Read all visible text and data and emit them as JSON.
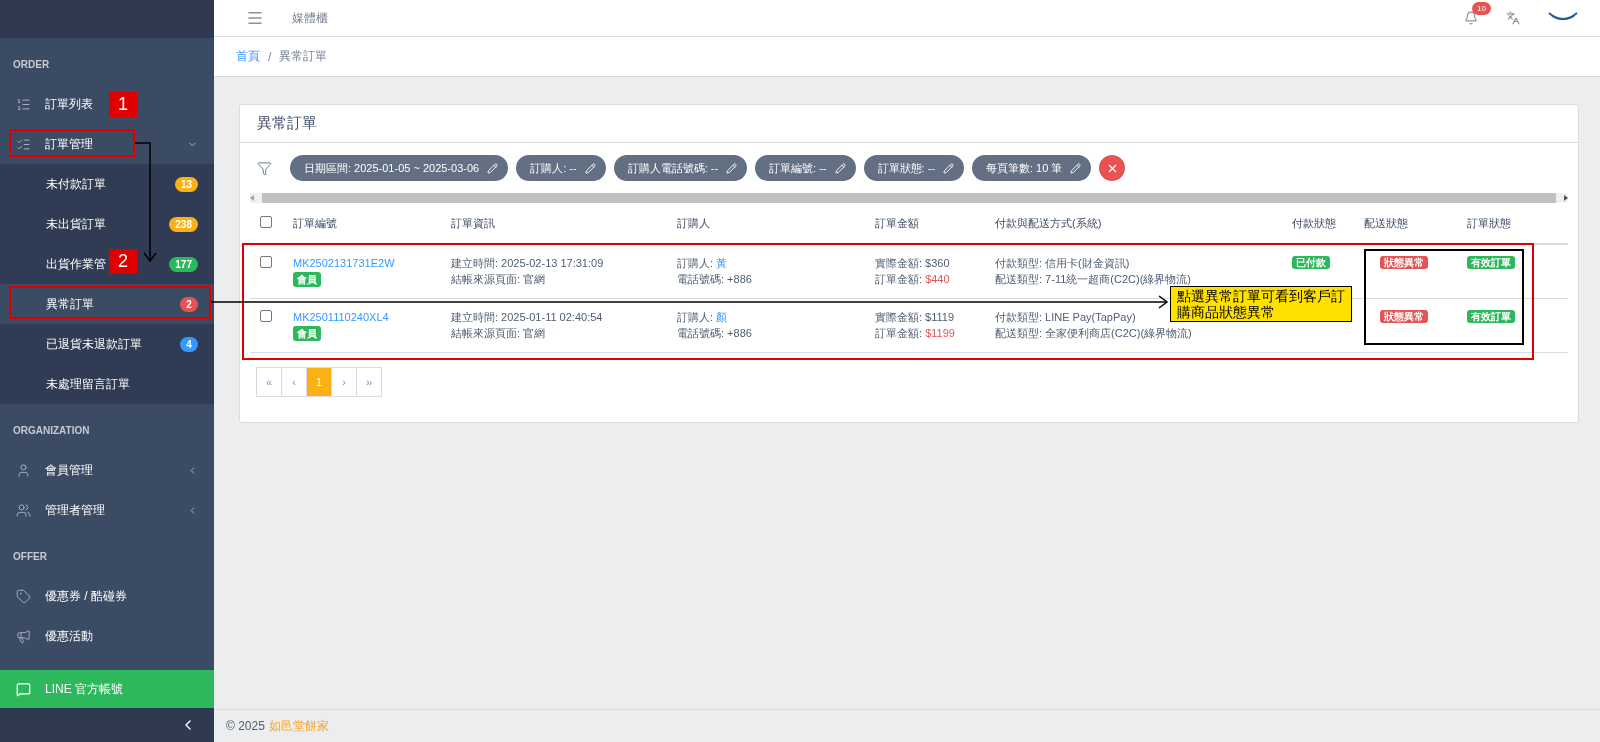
{
  "sidebar": {
    "sections": [
      {
        "heading": "ORDER",
        "items": [
          {
            "label": "訂單列表"
          },
          {
            "label": "訂單管理",
            "expanded": true,
            "children": [
              {
                "label": "未付款訂單",
                "selected": false,
                "badge": {
                  "text": "13",
                  "color": "#f9b115"
                }
              },
              {
                "label": "未出貨訂單",
                "selected": false,
                "badge": {
                  "text": "238",
                  "color": "#f9b115"
                }
              },
              {
                "label": "出貨作業管",
                "selected": false,
                "badge": {
                  "text": "177",
                  "color": "#2eb85c"
                }
              },
              {
                "label": "異常訂單",
                "selected": true,
                "badge": {
                  "text": "2",
                  "color": "#e55353"
                }
              },
              {
                "label": "已退貨未退款訂單",
                "selected": false,
                "badge": {
                  "text": "4",
                  "color": "#3399ff"
                }
              },
              {
                "label": "未處理留言訂單",
                "selected": false
              }
            ]
          }
        ]
      },
      {
        "heading": "ORGANIZATION",
        "items": [
          {
            "label": "會員管理",
            "expanded": false
          },
          {
            "label": "管理者管理",
            "expanded": false
          }
        ]
      },
      {
        "heading": "OFFER",
        "items": [
          {
            "label": "優惠券 / 酷碰券"
          },
          {
            "label": "優惠活動"
          }
        ]
      }
    ],
    "line_button": {
      "label": "LINE 官方帳號"
    }
  },
  "header": {
    "title": "媒體櫃",
    "notification_count": "10"
  },
  "breadcrumb": {
    "items": [
      "首頁",
      "異常訂單"
    ],
    "separator": "/"
  },
  "card": {
    "title": "異常訂單",
    "filters": [
      "日期區間: 2025-01-05 ~ 2025-03-06",
      "訂購人: --",
      "訂購人電話號碼: --",
      "訂單編號: --",
      "訂單狀態: --",
      "每頁筆數: 10 筆"
    ],
    "table": {
      "header_checked": false,
      "columns": [
        "訂單編號",
        "訂單資訊",
        "訂購人",
        "訂單金額",
        "付款與配送方式(系統)",
        "付款狀態",
        "配送狀態",
        "訂單狀態"
      ],
      "rows": [
        {
          "checked": false,
          "order_no": "MK2502131731E2W",
          "tag": "會員",
          "created": "建立時間: 2025-02-13 17:31:09",
          "source": "結帳來源頁面: 官網",
          "buyer": {
            "label": "訂購人:",
            "value": "黃"
          },
          "phone": "電話號碼: +886",
          "actual": "實際金額: $360",
          "total": {
            "label": "訂單金額:",
            "value": "$440"
          },
          "payment": "付款類型: 信用卡(財金資訊)",
          "shipping": "配送類型: 7-11統一超商(C2C)(綠界物流)",
          "pay_status": {
            "text": "已付款",
            "color": "#2eb85c"
          },
          "ship_status": {
            "text": "狀態異常",
            "color": "#e55353"
          },
          "order_status": {
            "text": "有效訂單",
            "color": "#2eb85c"
          }
        },
        {
          "checked": false,
          "order_no": "MK2501110240XL4",
          "tag": "會員",
          "created": "建立時間: 2025-01-11 02:40:54",
          "source": "結帳來源頁面: 官網",
          "buyer": {
            "label": "訂購人:",
            "value": "顏"
          },
          "phone": "電話號碼: +886",
          "actual": "實際金額: $1119",
          "total": {
            "label": "訂單金額:",
            "value": "$1199"
          },
          "payment": "付款類型: LINE Pay(TapPay)",
          "shipping": "配送類型: 全家便利商店(C2C)(綠界物流)",
          "ship_status": {
            "text": "狀態異常",
            "color": "#e55353"
          },
          "order_status": {
            "text": "有效訂單",
            "color": "#2eb85c"
          }
        }
      ]
    },
    "pagination": [
      {
        "label": "«",
        "selected": false
      },
      {
        "label": "‹",
        "selected": false
      },
      {
        "label": "1",
        "selected": true
      },
      {
        "label": "›",
        "selected": false
      },
      {
        "label": "»",
        "selected": false
      }
    ]
  },
  "footer": {
    "copyright": "© 2025",
    "link": "如邑堂餅家"
  },
  "annotations": {
    "markers": [
      "1",
      "2"
    ],
    "callout": "點選異常訂單可看到客戶訂購商品狀態異常"
  }
}
